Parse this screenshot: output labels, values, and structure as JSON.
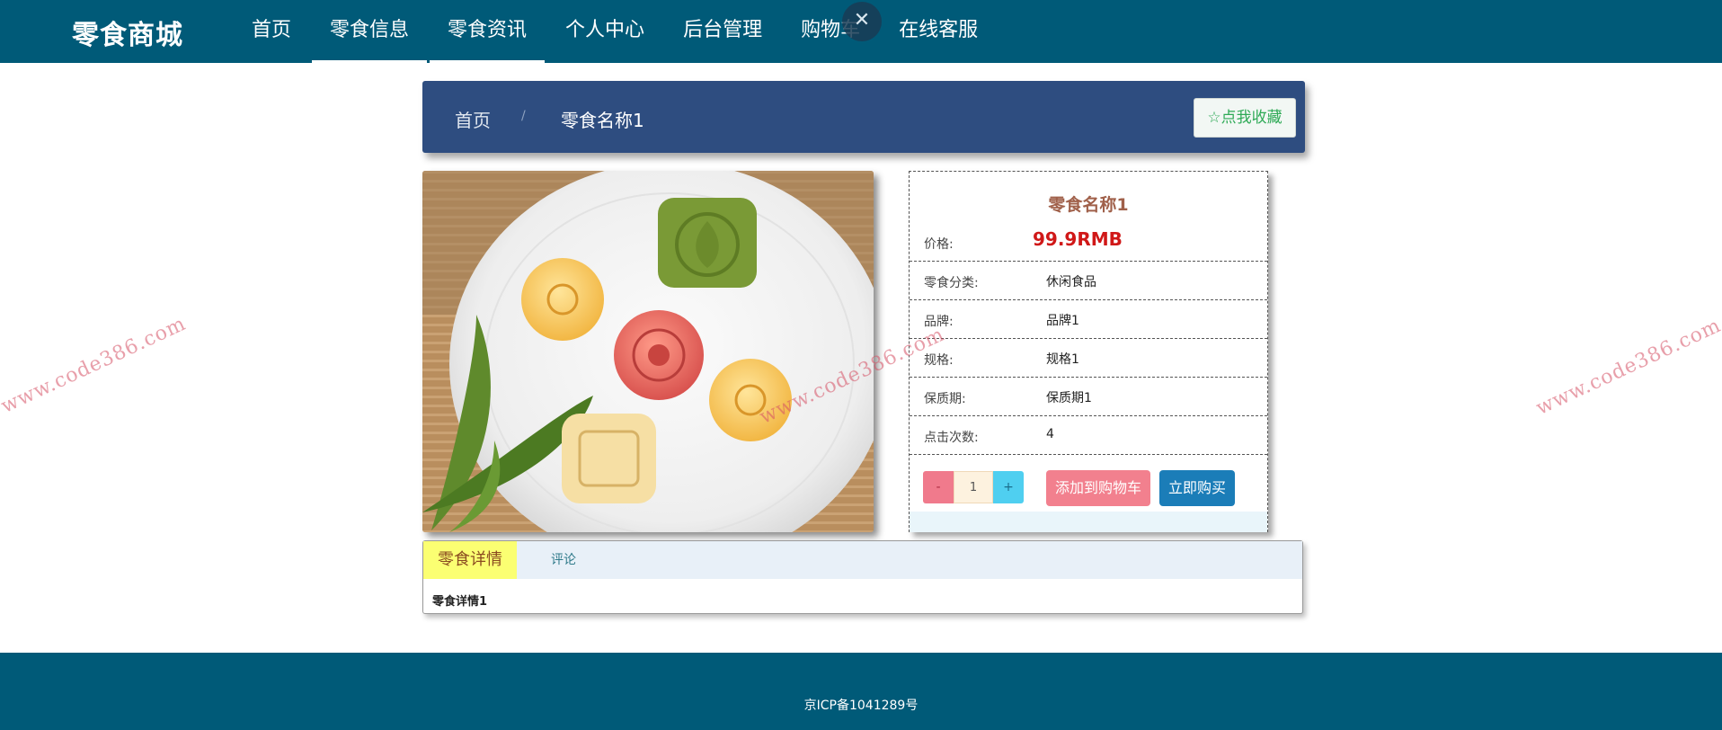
{
  "brand": "零食商城",
  "nav": {
    "items": [
      {
        "label": "首页"
      },
      {
        "label": "零食信息"
      },
      {
        "label": "零食资讯"
      },
      {
        "label": "个人中心"
      },
      {
        "label": "后台管理"
      },
      {
        "label": "购物车"
      },
      {
        "label": "在线客服"
      }
    ],
    "close_glyph": "✕"
  },
  "breadcrumb": {
    "home": "首页",
    "separator": "/",
    "current": "零食名称1"
  },
  "favorite_button": "☆点我收藏",
  "product": {
    "image_icon": "mooncake-photo",
    "name": "零食名称1",
    "price_label": "价格:",
    "price": "99.9RMB",
    "fields": [
      {
        "label": "零食分类:",
        "value": "休闲食品"
      },
      {
        "label": "品牌:",
        "value": "品牌1"
      },
      {
        "label": "规格:",
        "value": "规格1"
      },
      {
        "label": "保质期:",
        "value": "保质期1"
      },
      {
        "label": "点击次数:",
        "value": "4"
      }
    ],
    "qty_minus": "-",
    "quantity": "1",
    "qty_plus": "+",
    "add_to_cart": "添加到购物车",
    "buy_now": "立即购买"
  },
  "tabs": {
    "items": [
      {
        "label": "零食详情"
      },
      {
        "label": "评论"
      }
    ],
    "content": "零食详情1"
  },
  "footer": {
    "icp": "京ICP备1041289号"
  },
  "watermark": "www.code386.com",
  "colors": {
    "nav_bg": "#005a78",
    "crumb_bg": "#2e4d80",
    "price": "#d01818",
    "cart_button": "#f2808e",
    "buy_button": "#1b7db8"
  }
}
